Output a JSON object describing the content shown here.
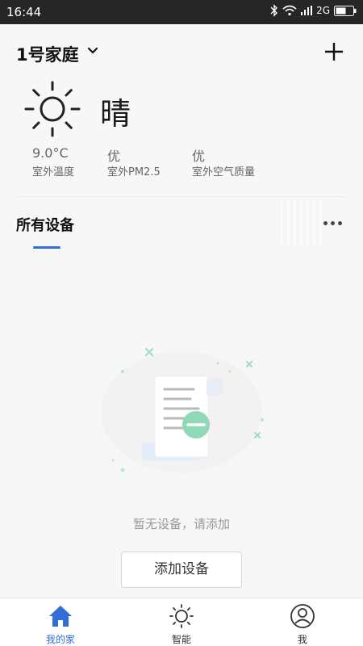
{
  "status_bar": {
    "time": "16:44",
    "network": "2G"
  },
  "header": {
    "home_name": "1号家庭"
  },
  "weather": {
    "condition": "晴",
    "stats": [
      {
        "value": "9.0°C",
        "label": "室外温度"
      },
      {
        "value": "优",
        "label": "室外PM2.5"
      },
      {
        "value": "优",
        "label": "室外空气质量"
      }
    ]
  },
  "section": {
    "title": "所有设备"
  },
  "empty_state": {
    "message": "暂无设备，请添加",
    "button_label": "添加设备"
  },
  "bottom_nav": {
    "items": [
      {
        "label": "我的家",
        "icon": "home-icon",
        "active": true
      },
      {
        "label": "智能",
        "icon": "sun-icon",
        "active": false
      },
      {
        "label": "我",
        "icon": "user-icon",
        "active": false
      }
    ]
  },
  "colors": {
    "accent": "#2f6fd6",
    "status_bar": "#262626",
    "badge_green": "#8fd9b6"
  }
}
